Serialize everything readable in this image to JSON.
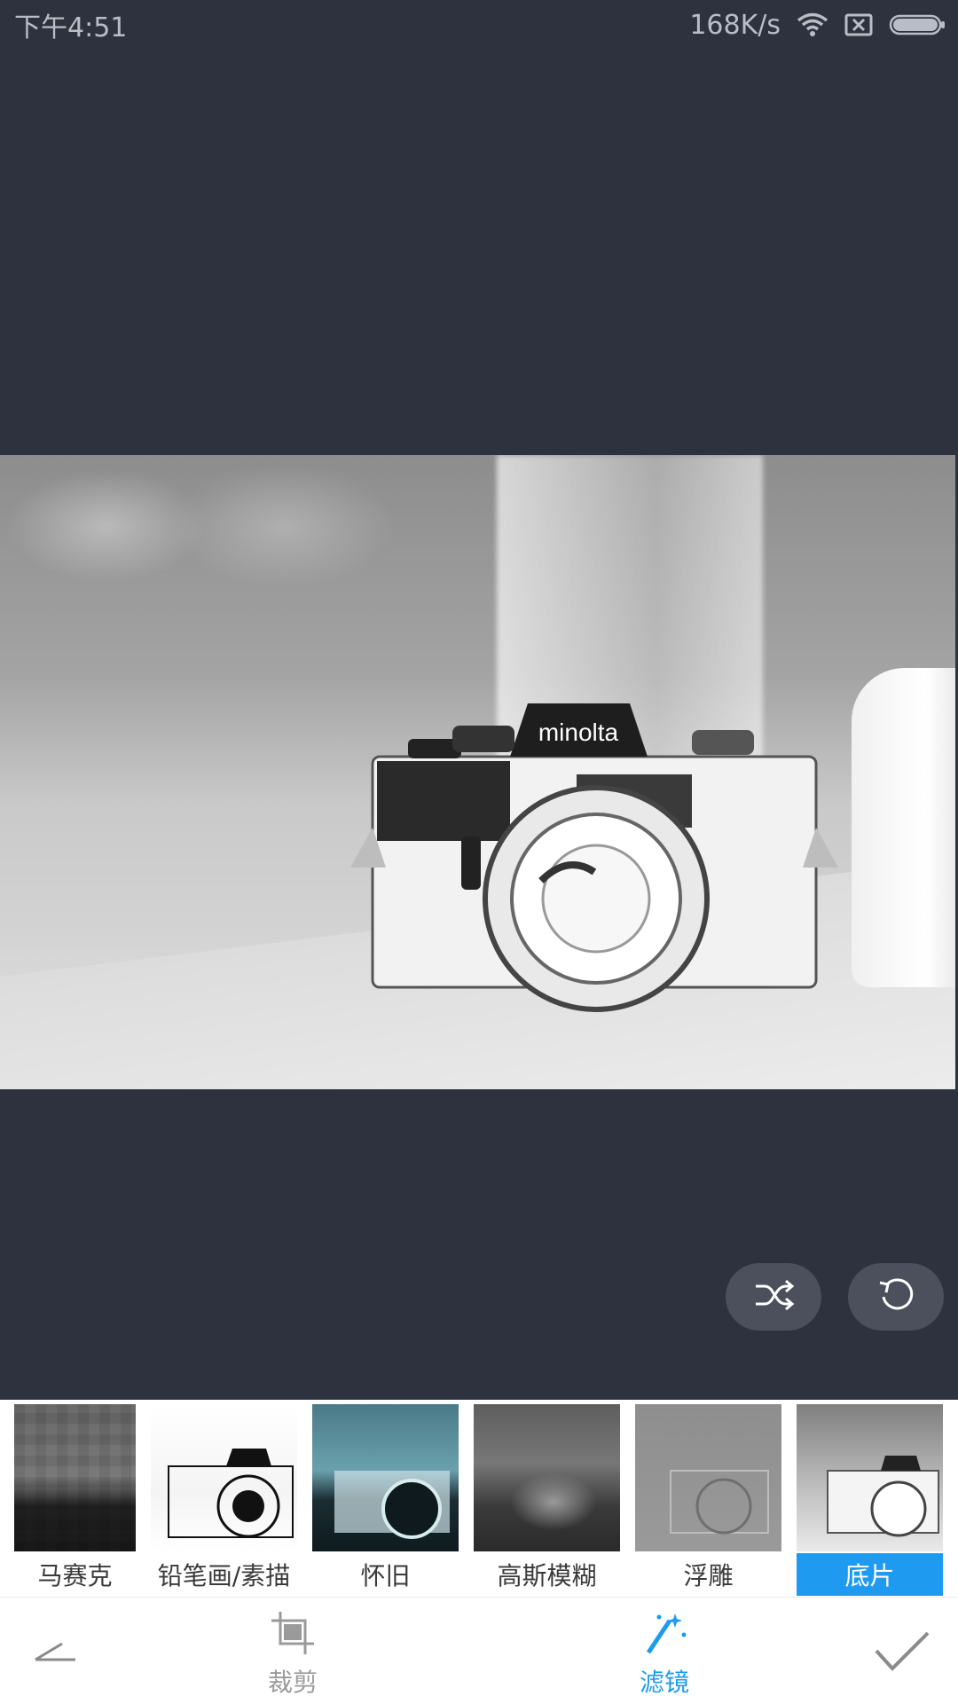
{
  "status_bar": {
    "time": "下午4:51",
    "net_speed": "168K/s"
  },
  "photo": {
    "brand_text": "minolta",
    "filter_applied": "底片"
  },
  "floating_actions": {
    "shuffle_icon": "shuffle-icon",
    "rotate_icon": "rotate-icon"
  },
  "filters": [
    {
      "label": "马赛克",
      "active": false
    },
    {
      "label": "铅笔画/素描",
      "active": false
    },
    {
      "label": "怀旧",
      "active": false
    },
    {
      "label": "高斯模糊",
      "active": false
    },
    {
      "label": "浮雕",
      "active": false
    },
    {
      "label": "底片",
      "active": true
    }
  ],
  "toolbar": {
    "crop_label": "裁剪",
    "filter_label": "滤镜",
    "active_tool": "滤镜"
  },
  "colors": {
    "background": "#2e323e",
    "accent": "#1e9bf0",
    "fab": "#4b505c"
  }
}
